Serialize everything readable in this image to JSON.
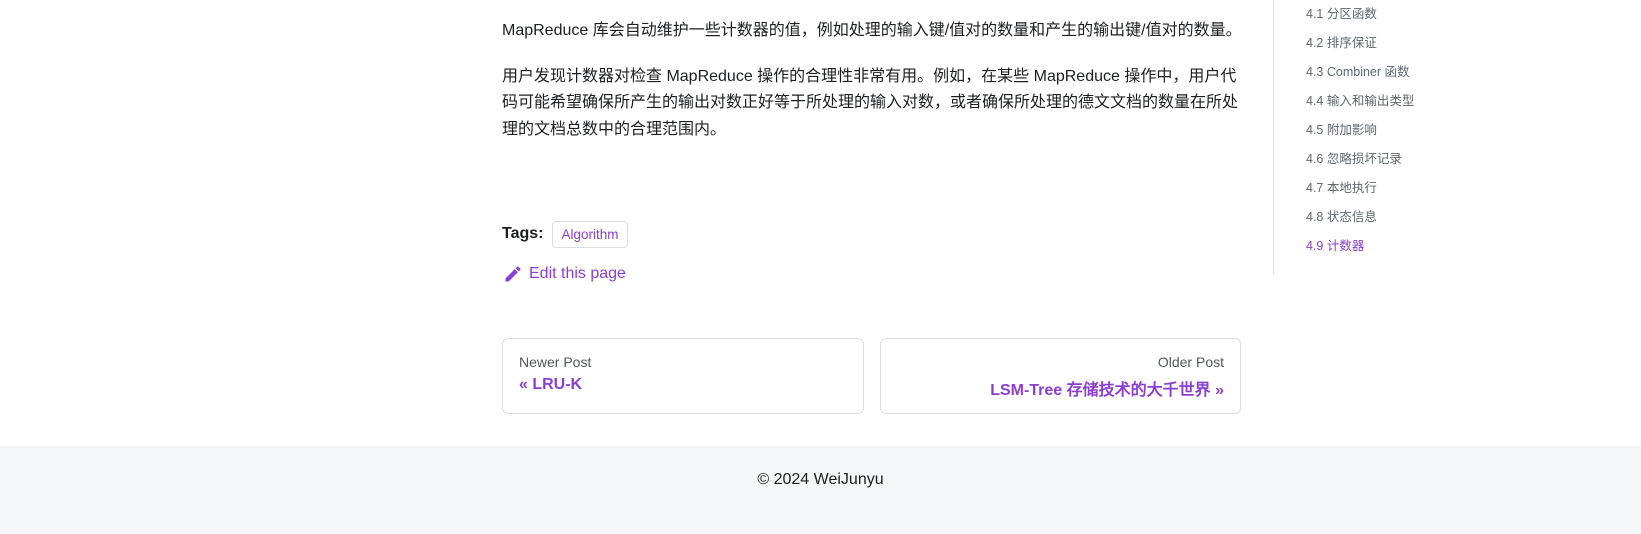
{
  "article": {
    "paragraphs": [
      "MapReduce 库会自动维护一些计数器的值，例如处理的输入键/值对的数量和产生的输出键/值对的数量。",
      "用户发现计数器对检查 MapReduce 操作的合理性非常有用。例如，在某些 MapReduce 操作中，用户代码可能希望确保所产生的输出对数正好等于所处理的输入对数，或者确保所处理的德文文档的数量在所处理的文档总数中的合理范围内。"
    ]
  },
  "tags": {
    "label": "Tags:",
    "items": [
      "Algorithm"
    ]
  },
  "edit": {
    "label": "Edit this page",
    "icon": "pencil-icon"
  },
  "pager": {
    "newer": {
      "sub": "Newer Post",
      "title": "« LRU-K"
    },
    "older": {
      "sub": "Older Post",
      "title": "LSM-Tree 存储技术的大千世界 »"
    }
  },
  "toc": {
    "items": [
      {
        "label": "4.1 分区函数",
        "active": false
      },
      {
        "label": "4.2 排序保证",
        "active": false
      },
      {
        "label": "4.3 Combiner 函数",
        "active": false
      },
      {
        "label": "4.4 输入和输出类型",
        "active": false
      },
      {
        "label": "4.5 附加影响",
        "active": false
      },
      {
        "label": "4.6 忽略损坏记录",
        "active": false
      },
      {
        "label": "4.7 本地执行",
        "active": false
      },
      {
        "label": "4.8 状态信息",
        "active": false
      },
      {
        "label": "4.9 计数器",
        "active": true
      }
    ]
  },
  "footer": {
    "copyright": "© 2024 WeiJunyu"
  },
  "colors": {
    "accent": "#8c3ed2",
    "text": "#1c1e21",
    "muted": "#606770",
    "footer_bg": "#f5f6f7",
    "border": "#dadde1"
  }
}
